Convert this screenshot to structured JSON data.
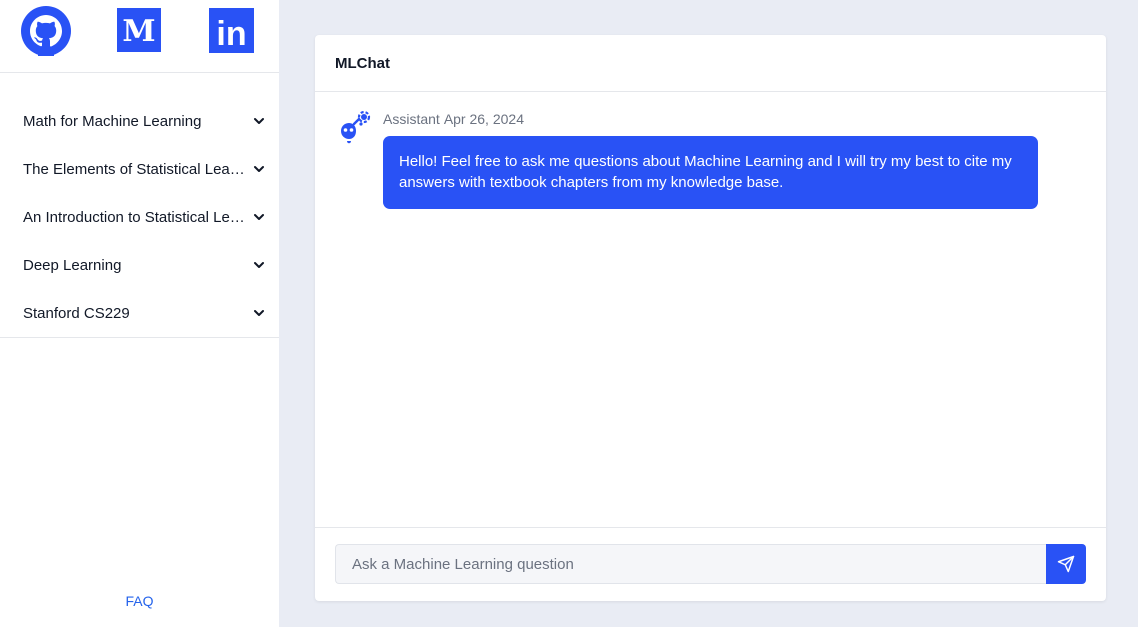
{
  "sidebar": {
    "social": [
      {
        "name": "GitHub",
        "icon": "github-icon"
      },
      {
        "name": "Medium",
        "icon": "medium-icon",
        "glyph": "M"
      },
      {
        "name": "LinkedIn",
        "icon": "linkedin-icon",
        "glyph": "in"
      }
    ],
    "items": [
      {
        "label": "Math for Machine Learning"
      },
      {
        "label": "The Elements of Statistical Learning"
      },
      {
        "label": "An Introduction to Statistical Learning"
      },
      {
        "label": "Deep Learning"
      },
      {
        "label": "Stanford CS229"
      }
    ],
    "faq_label": "FAQ"
  },
  "chat": {
    "title": "MLChat",
    "messages": [
      {
        "author": "Assistant",
        "date": "Apr 26, 2024",
        "text": "Hello! Feel free to ask me questions about Machine Learning and I will try my best to cite my answers with textbook chapters from my knowledge base."
      }
    ],
    "input": {
      "placeholder": "Ask a Machine Learning question",
      "value": ""
    }
  },
  "colors": {
    "accent": "#2952f5",
    "background": "#e9ecf4",
    "link": "#2563eb"
  }
}
